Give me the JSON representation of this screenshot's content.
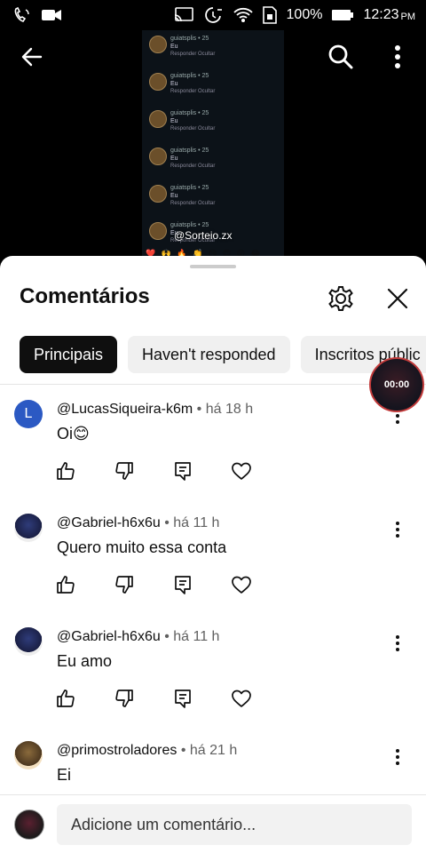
{
  "status_bar": {
    "battery": "100%",
    "time": "12:23",
    "ampm": "PM"
  },
  "video": {
    "overlay_handle": "@Sorteio.zx",
    "rows": [
      {
        "name": "guiatsplis • 25",
        "text": "Eu",
        "actions": "Responder  Ocultar"
      },
      {
        "name": "guiatsplis • 25",
        "text": "Eu",
        "actions": "Responder  Ocultar"
      },
      {
        "name": "guiatsplis • 25",
        "text": "Eu",
        "actions": "Responder  Ocultar"
      },
      {
        "name": "guiatsplis • 25",
        "text": "Eu",
        "actions": "Responder  Ocultar"
      },
      {
        "name": "guiatsplis • 25",
        "text": "Eu",
        "actions": "Responder  Ocultar"
      },
      {
        "name": "guiatsplis • 25",
        "text": "Eu",
        "actions": "Responder  Ocultar"
      }
    ],
    "emoji_strip": "❤️ 🙌 🔥 👏 😢 😍 😮 😂"
  },
  "sheet": {
    "title": "Comentários",
    "chips": [
      "Principais",
      "Haven't responded",
      "Inscritos públic"
    ],
    "floating_badge": "00:00"
  },
  "comments": [
    {
      "avatar_letter": "L",
      "author": "@LucasSiqueira-k6m",
      "time": "há 18 h",
      "text": "Oi😊"
    },
    {
      "avatar_letter": "",
      "author": "@Gabriel-h6x6u",
      "time": "há 11 h",
      "text": "Quero muito essa conta"
    },
    {
      "avatar_letter": "",
      "author": "@Gabriel-h6x6u",
      "time": "há 11 h",
      "text": "Eu amo"
    },
    {
      "avatar_letter": "",
      "author": "@primostroladores",
      "time": "há 21 h",
      "text": "Ei"
    }
  ],
  "input": {
    "placeholder": "Adicione um comentário..."
  },
  "icons": {
    "back": "arrow-left-icon",
    "search": "search-icon",
    "more": "more-vert-icon",
    "settings": "gear-icon",
    "close": "close-icon",
    "like": "thumb-up-icon",
    "dislike": "thumb-down-icon",
    "reply": "reply-icon",
    "heart": "heart-icon"
  },
  "colors": {
    "chip_active_bg": "#0f0f0f",
    "chip_bg": "#f0f0f0",
    "avatar_letter_bg": "#2b59c3"
  }
}
